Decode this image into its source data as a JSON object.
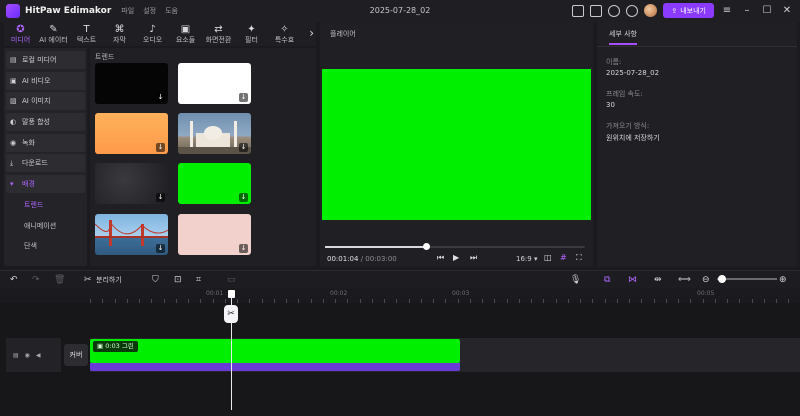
{
  "app": {
    "name": "HitPaw Edimakor",
    "menu": [
      "파일",
      "설정",
      "도움"
    ],
    "doc_title": "2025-07-28_02",
    "export_label": "내보내기"
  },
  "tabs": [
    {
      "label": "미디어",
      "icon": "media-icon",
      "glyph": "✪",
      "active": true
    },
    {
      "label": "AI 에이터",
      "icon": "ai-creator-icon",
      "glyph": "✎"
    },
    {
      "label": "텍스트",
      "icon": "text-icon",
      "glyph": "T"
    },
    {
      "label": "자막",
      "icon": "subtitle-icon",
      "glyph": "⌘"
    },
    {
      "label": "오디오",
      "icon": "audio-icon",
      "glyph": "♪"
    },
    {
      "label": "요소들",
      "icon": "elements-icon",
      "glyph": "▣"
    },
    {
      "label": "화면전환",
      "icon": "transition-icon",
      "glyph": "⇄"
    },
    {
      "label": "필터",
      "icon": "filter-icon",
      "glyph": "✦"
    },
    {
      "label": "특수효",
      "icon": "effects-icon",
      "glyph": "✧"
    }
  ],
  "sidebar": {
    "items": [
      {
        "label": "로컬 미디어",
        "glyph": "▤"
      },
      {
        "label": "AI 비디오",
        "glyph": "▣"
      },
      {
        "label": "AI 이미지",
        "glyph": "▨"
      },
      {
        "label": "말풍 합성",
        "glyph": "◐"
      },
      {
        "label": "녹화",
        "glyph": "◉"
      },
      {
        "label": "다운로드",
        "glyph": "⤓"
      },
      {
        "label": "배경",
        "glyph": "▾",
        "open": true
      }
    ],
    "sub_items": [
      {
        "label": "트렌드",
        "active": true
      },
      {
        "label": "애니메이션"
      },
      {
        "label": "단색"
      }
    ]
  },
  "media": {
    "section_label": "트렌드"
  },
  "player": {
    "label": "플레이어",
    "current_time": "00:01:04",
    "duration": "00:03:00",
    "progress": 0.39,
    "ratio_label": "16:9",
    "preview_color": "#00ee00"
  },
  "detail": {
    "tab_label": "세부 사항",
    "fields": [
      {
        "label": "이름:",
        "value": "2025-07-28_02"
      },
      {
        "label": "프레임 속도:",
        "value": "30"
      },
      {
        "label": "가져오기 방식:",
        "value": "원위치에 저장하기"
      }
    ]
  },
  "toolbar": {
    "split_label": "분리하기"
  },
  "ruler": {
    "labels": [
      "00:01",
      "00:02",
      "00:03",
      "00:05"
    ]
  },
  "timeline": {
    "cover_label": "커버",
    "clip_label": "0:03  그린",
    "clip_color": "#00ee00",
    "clip_bar_color": "#6a3ad6"
  },
  "colors": {
    "accent": "#a64dff",
    "export_button": "#8a3bff"
  }
}
